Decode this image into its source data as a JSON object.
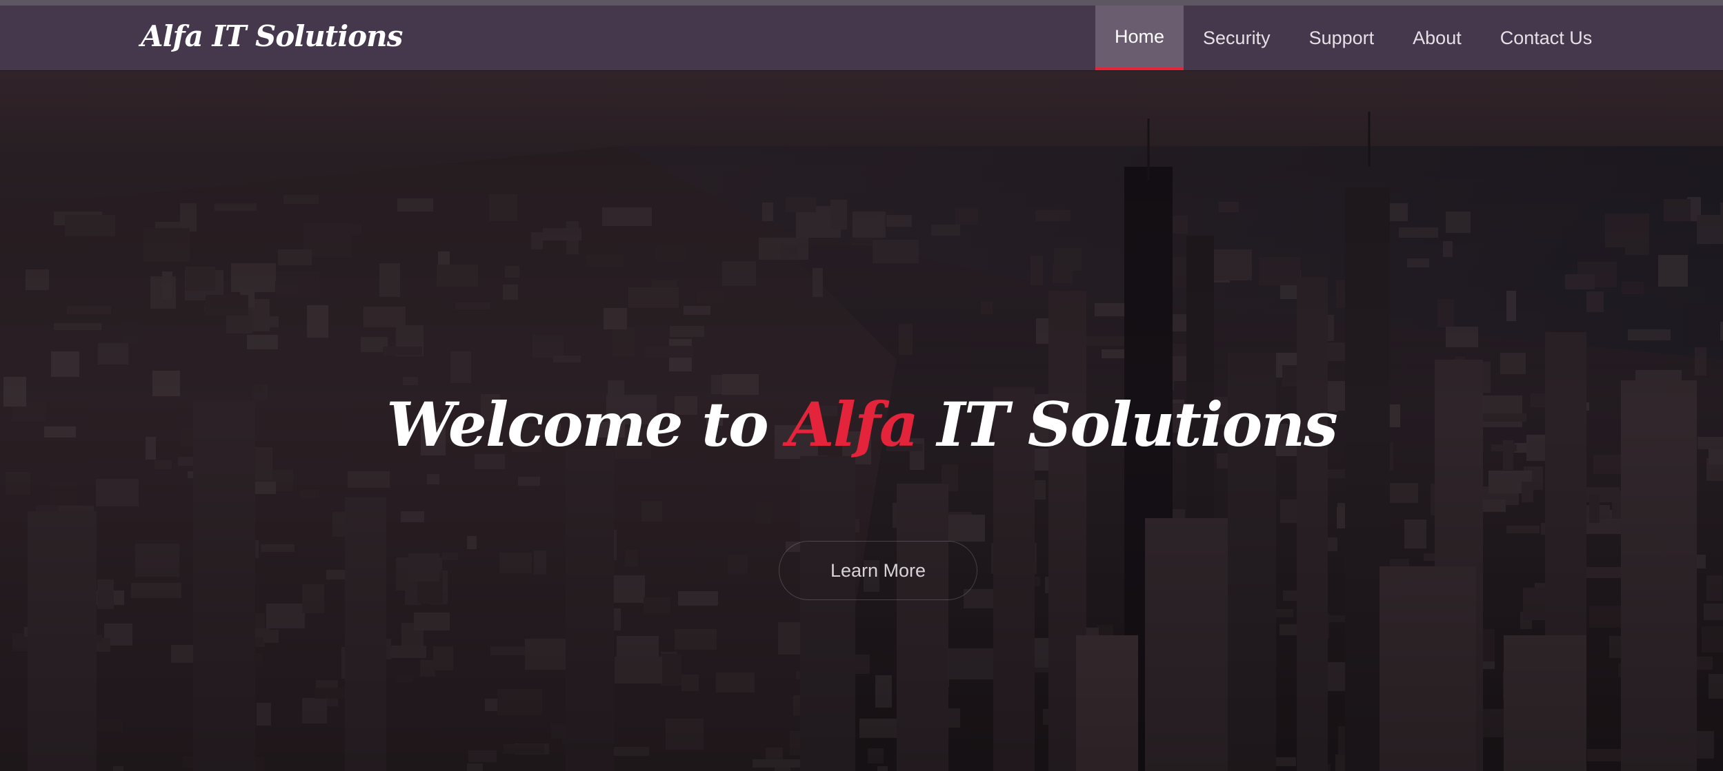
{
  "navbar": {
    "brand": "Alfa IT Solutions",
    "items": [
      {
        "label": "Home",
        "active": true
      },
      {
        "label": "Security",
        "active": false
      },
      {
        "label": "Support",
        "active": false
      },
      {
        "label": "About",
        "active": false
      },
      {
        "label": "Contact Us",
        "active": false
      }
    ]
  },
  "hero": {
    "title_prefix": "Welcome to ",
    "title_accent": "Alfa",
    "title_suffix": " IT Solutions",
    "button_label": "Learn More",
    "background": "aerial-city-skyline-image"
  },
  "colors": {
    "navbar_bg": "#45374c",
    "active_tab_bg": "#6b5d70",
    "accent": "#e4243a",
    "text": "#ffffff"
  }
}
